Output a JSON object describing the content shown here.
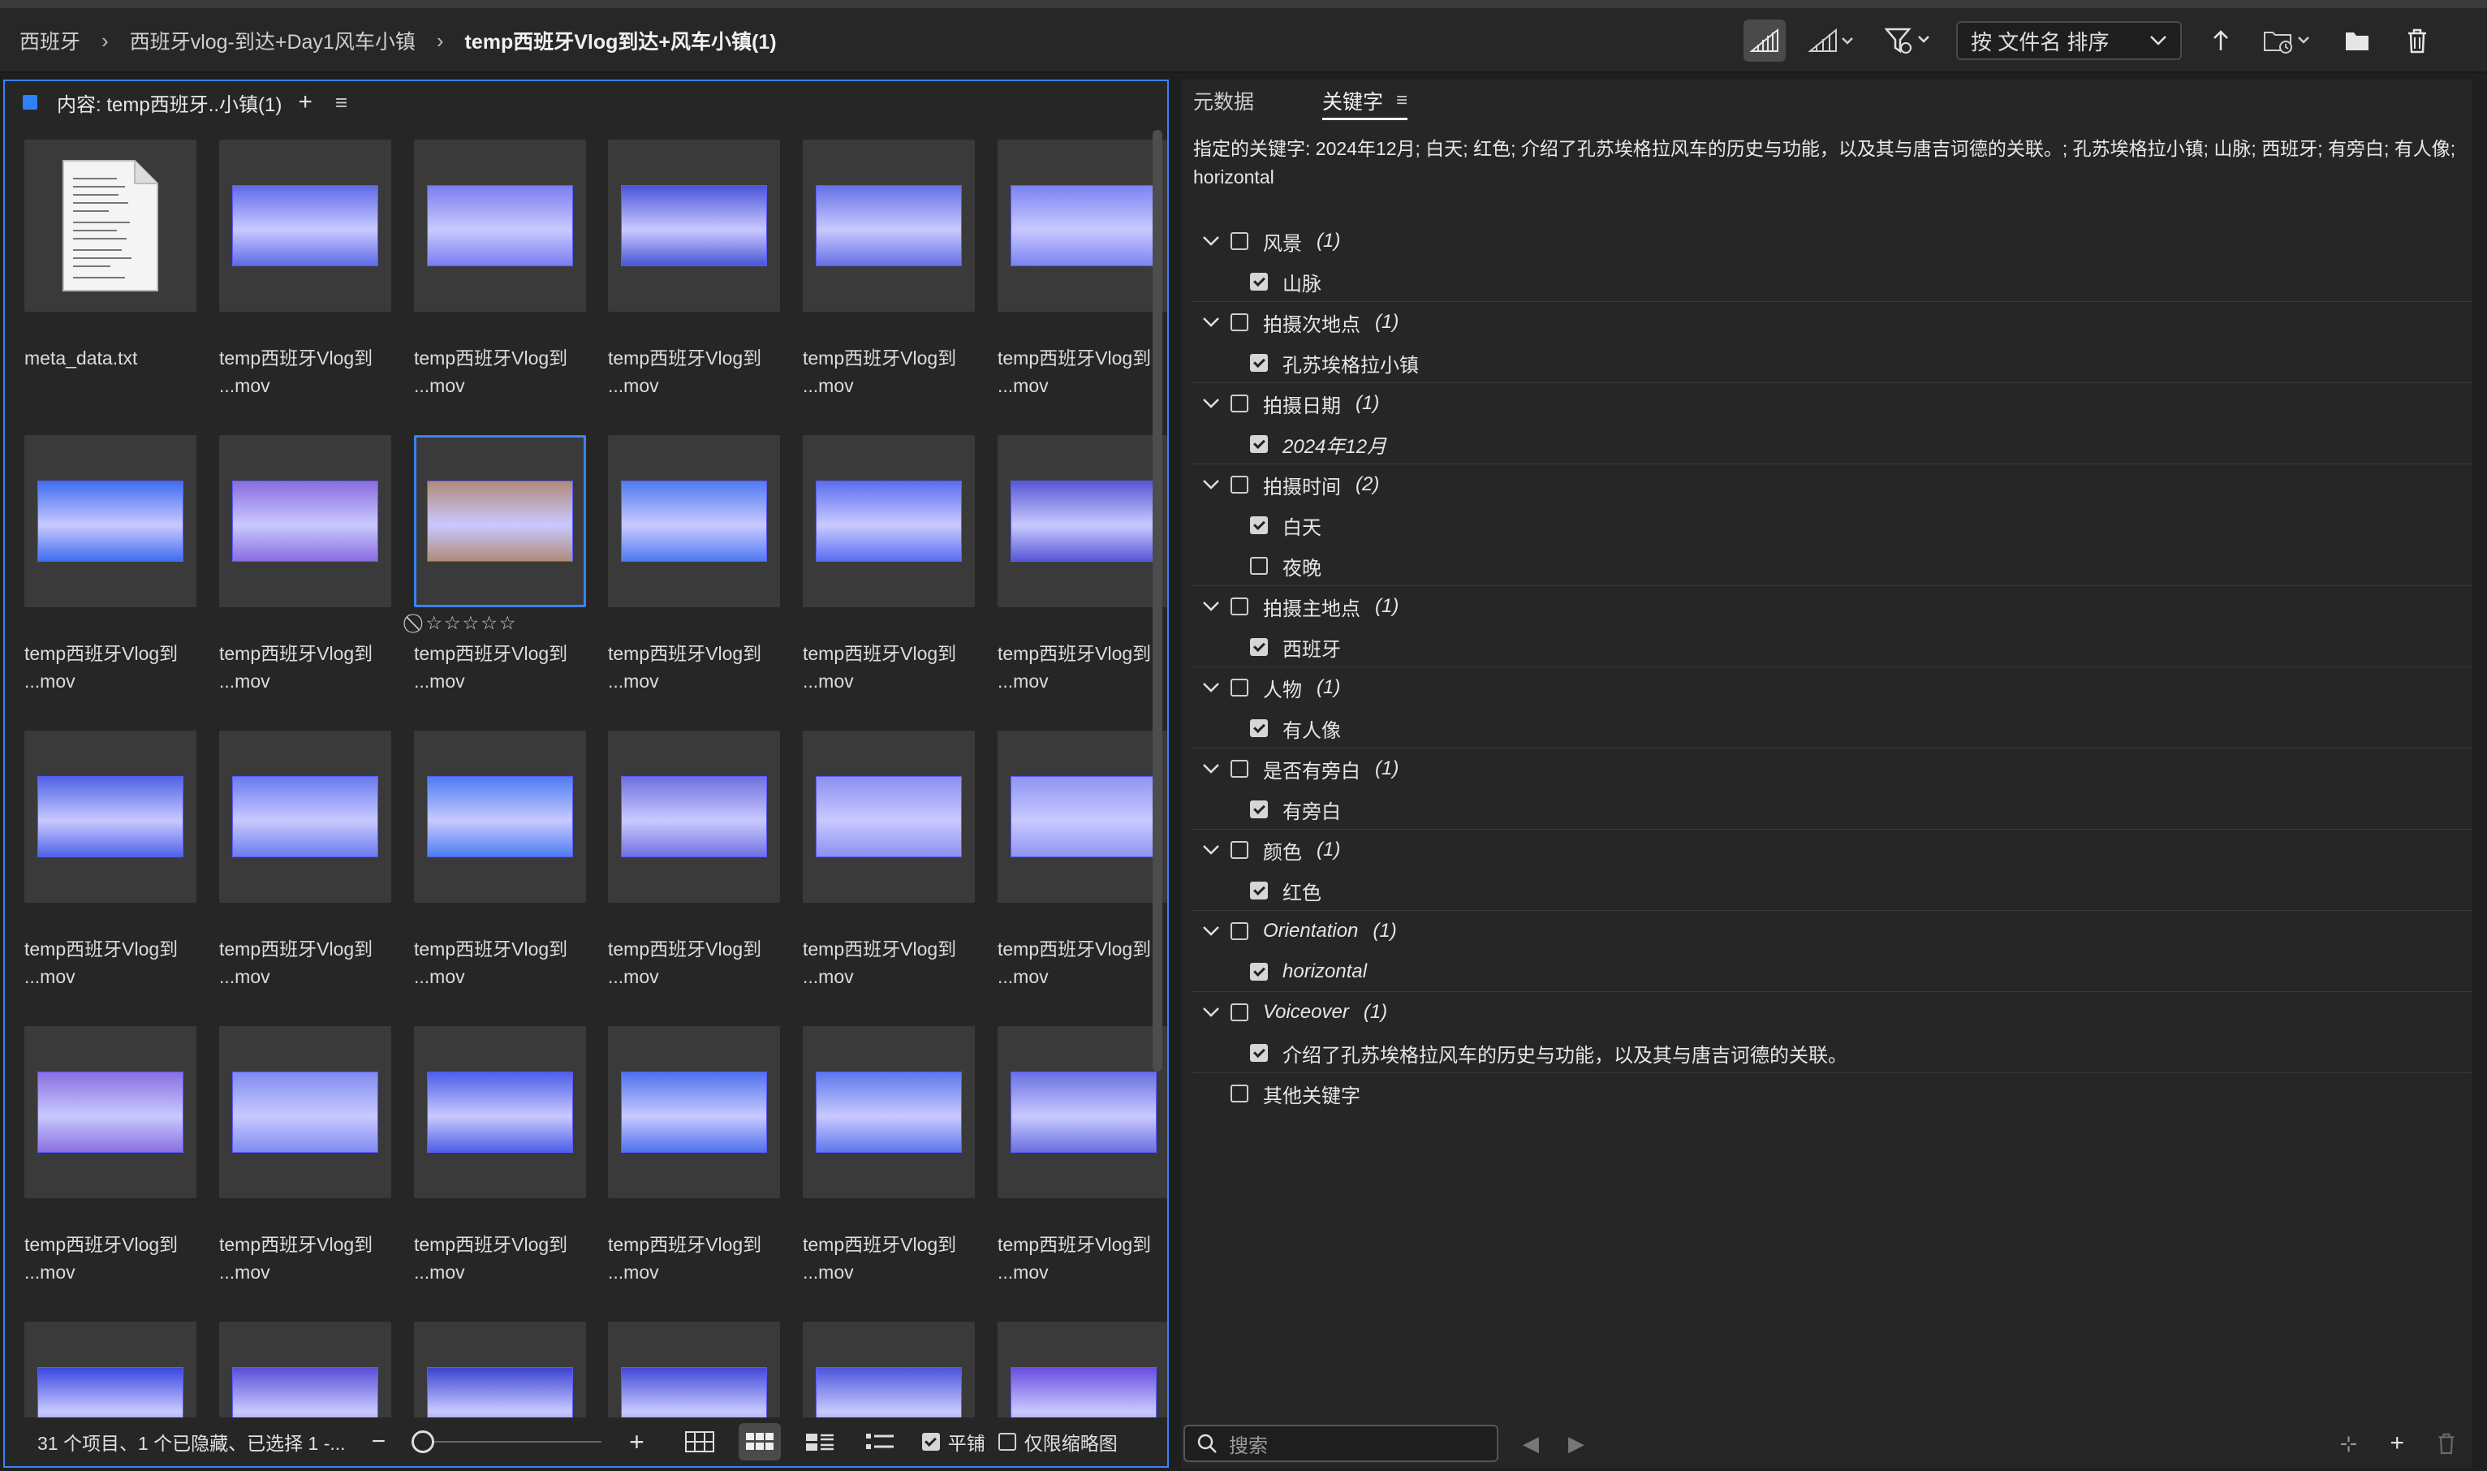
{
  "breadcrumb": {
    "items": [
      "西班牙",
      "西班牙vlog-到达+Day1风车小镇",
      "temp西班牙Vlog到达+风车小镇(1)"
    ]
  },
  "toolbar": {
    "sort_label": "按 文件名 排序",
    "icons": [
      "quality-icon",
      "quality-dropdown-icon",
      "filter-icon",
      "sort-ascending-icon",
      "new-folder-dropdown-icon",
      "folder-icon",
      "trash-icon"
    ]
  },
  "content_panel": {
    "title": "内容: temp西班牙..小镇(1)",
    "files": [
      {
        "l1": "meta_data.txt",
        "l2": "",
        "kind": "doc"
      },
      {
        "l1": "temp西班牙Vlog到",
        "l2": "...mov",
        "c": "#5f6be8"
      },
      {
        "l1": "temp西班牙Vlog到",
        "l2": "...mov",
        "c": "#7a7df0"
      },
      {
        "l1": "temp西班牙Vlog到",
        "l2": "...mov",
        "c": "#4a55d8"
      },
      {
        "l1": "temp西班牙Vlog到",
        "l2": "...mov",
        "c": "#6670e6"
      },
      {
        "l1": "temp西班牙Vlog到",
        "l2": "...mov",
        "c": "#7b84f2"
      },
      {
        "l1": "temp西班牙Vlog到",
        "l2": "...mov",
        "c": "#3f6df0"
      },
      {
        "l1": "temp西班牙Vlog到",
        "l2": "...mov",
        "c": "#8a6ce0"
      },
      {
        "l1": "temp西班牙Vlog到",
        "l2": "...mov",
        "c": "#b08a7a",
        "selected": true,
        "rating": "⃠ ☆☆☆☆☆"
      },
      {
        "l1": "temp西班牙Vlog到",
        "l2": "...mov",
        "c": "#4f7af2"
      },
      {
        "l1": "temp西班牙Vlog到",
        "l2": "...mov",
        "c": "#5a6ff0"
      },
      {
        "l1": "temp西班牙Vlog到",
        "l2": "...mov",
        "c": "#5757d6"
      },
      {
        "l1": "temp西班牙Vlog到",
        "l2": "...mov",
        "c": "#4f63e6"
      },
      {
        "l1": "temp西班牙Vlog到",
        "l2": "...mov",
        "c": "#6a7cef"
      },
      {
        "l1": "temp西班牙Vlog到",
        "l2": "...mov",
        "c": "#4c7cf0"
      },
      {
        "l1": "temp西班牙Vlog到",
        "l2": "...mov",
        "c": "#7070e0"
      },
      {
        "l1": "temp西班牙Vlog到",
        "l2": "...mov",
        "c": "#8c90f0"
      },
      {
        "l1": "temp西班牙Vlog到",
        "l2": "...mov",
        "c": "#8f95f2"
      },
      {
        "l1": "temp西班牙Vlog到",
        "l2": "...mov",
        "c": "#8b6fe0"
      },
      {
        "l1": "temp西班牙Vlog到",
        "l2": "...mov",
        "c": "#7f8cf0"
      },
      {
        "l1": "temp西班牙Vlog到",
        "l2": "...mov",
        "c": "#4d5fe8"
      },
      {
        "l1": "temp西班牙Vlog到",
        "l2": "...mov",
        "c": "#4f72ec"
      },
      {
        "l1": "temp西班牙Vlog到",
        "l2": "...mov",
        "c": "#5d78ec"
      },
      {
        "l1": "temp西班牙Vlog到",
        "l2": "...mov",
        "c": "#6a70e2"
      },
      {
        "l1": "",
        "l2": "",
        "c": "#3a48e0"
      },
      {
        "l1": "",
        "l2": "",
        "c": "#5a4ed8"
      },
      {
        "l1": "",
        "l2": "",
        "c": "#3c44d0"
      },
      {
        "l1": "",
        "l2": "",
        "c": "#4248d8"
      },
      {
        "l1": "",
        "l2": "",
        "c": "#4d55dc"
      },
      {
        "l1": "",
        "l2": "",
        "c": "#6a4ee0"
      }
    ],
    "footer": {
      "status": "31 个项目、1 个已隐藏、已选择 1 -...",
      "tile_label": "平铺",
      "thumb_only_label": "仅限缩略图",
      "tile_checked": true,
      "thumb_only_checked": false
    }
  },
  "right_panel": {
    "tabs": [
      "元数据",
      "关键字"
    ],
    "assigned_keywords": "指定的关键字: 2024年12月; 白天; 红色; 介绍了孔苏埃格拉风车的历史与功能，以及其与唐吉诃德的关联。; 孔苏埃格拉小镇; 山脉; 西班牙; 有旁白; 有人像; horizontal",
    "groups": [
      {
        "name": "风景",
        "count": "(1)",
        "italic": false,
        "children": [
          {
            "name": "山脉",
            "checked": true,
            "italic": false
          }
        ]
      },
      {
        "name": "拍摄次地点",
        "count": "(1)",
        "italic": false,
        "children": [
          {
            "name": "孔苏埃格拉小镇",
            "checked": true,
            "italic": false
          }
        ]
      },
      {
        "name": "拍摄日期",
        "count": "(1)",
        "italic": false,
        "children": [
          {
            "name": "2024年12月",
            "checked": true,
            "italic": true
          }
        ]
      },
      {
        "name": "拍摄时间",
        "count": "(2)",
        "italic": false,
        "children": [
          {
            "name": "白天",
            "checked": true,
            "italic": false
          },
          {
            "name": "夜晚",
            "checked": false,
            "italic": false
          }
        ]
      },
      {
        "name": "拍摄主地点",
        "count": "(1)",
        "italic": false,
        "children": [
          {
            "name": "西班牙",
            "checked": true,
            "italic": false
          }
        ]
      },
      {
        "name": "人物",
        "count": "(1)",
        "italic": false,
        "children": [
          {
            "name": "有人像",
            "checked": true,
            "italic": false
          }
        ]
      },
      {
        "name": "是否有旁白",
        "count": "(1)",
        "italic": false,
        "children": [
          {
            "name": "有旁白",
            "checked": true,
            "italic": false
          }
        ]
      },
      {
        "name": "颜色",
        "count": "(1)",
        "italic": false,
        "children": [
          {
            "name": "红色",
            "checked": true,
            "italic": false
          }
        ]
      },
      {
        "name": "Orientation",
        "count": "(1)",
        "italic": true,
        "children": [
          {
            "name": "horizontal",
            "checked": true,
            "italic": true
          }
        ]
      },
      {
        "name": "Voiceover",
        "count": "(1)",
        "italic": true,
        "children": [
          {
            "name": "介绍了孔苏埃格拉风车的历史与功能，以及其与唐吉诃德的关联。",
            "checked": true,
            "italic": false
          }
        ]
      }
    ],
    "other_keywords": "其他关键字",
    "search_placeholder": "搜索"
  }
}
